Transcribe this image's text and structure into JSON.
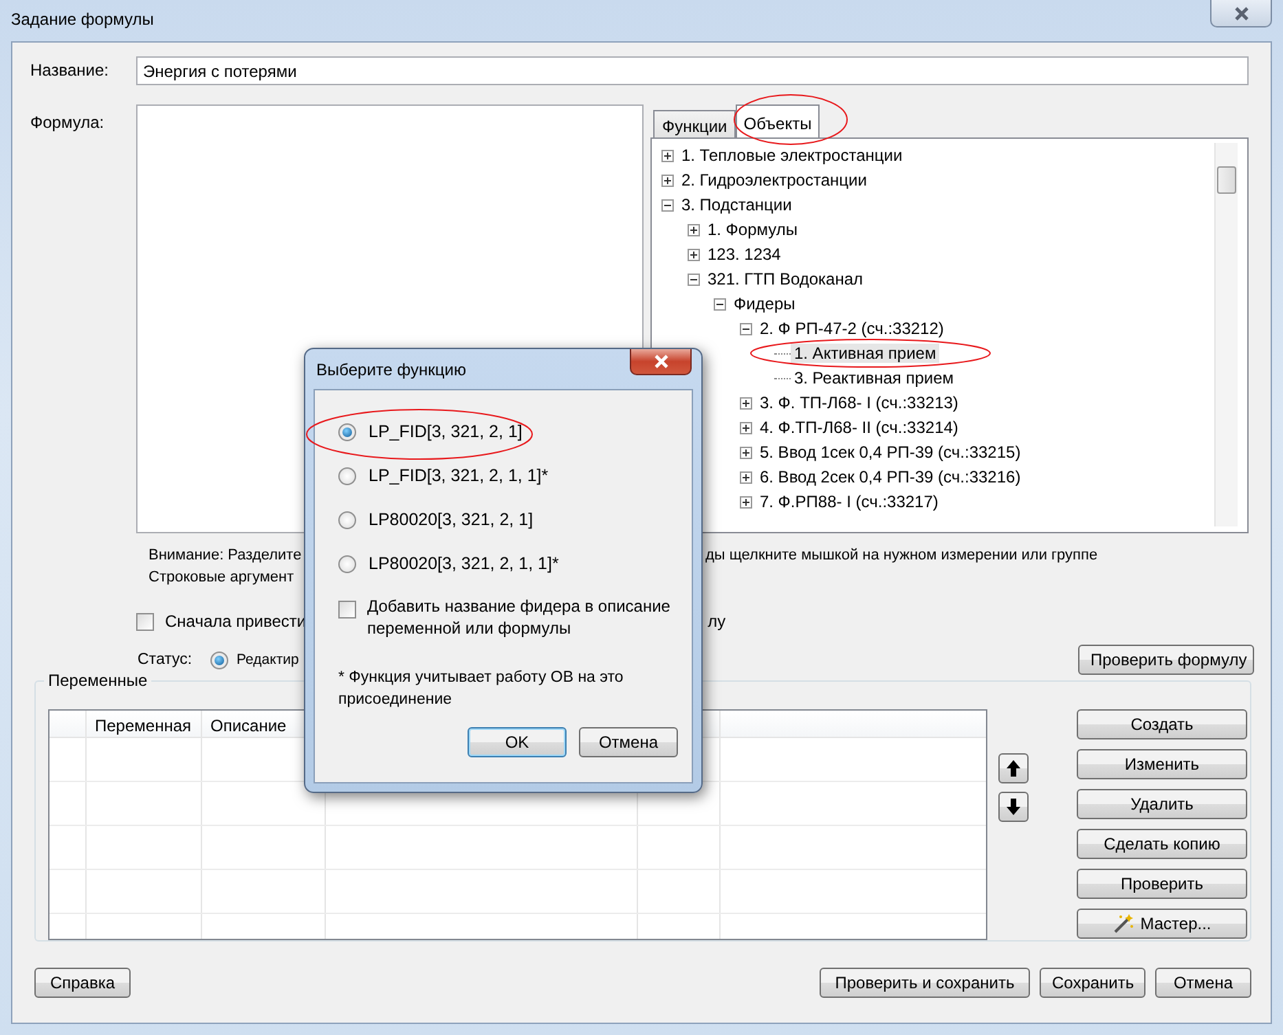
{
  "window": {
    "title": "Задание формулы"
  },
  "name_field": {
    "label": "Название:",
    "value": "Энергия с потерями"
  },
  "formula": {
    "label": "Формула:"
  },
  "tabs": [
    {
      "label": "Функции",
      "selected": false
    },
    {
      "label": "Объекты",
      "selected": true
    }
  ],
  "objects_tree": [
    {
      "label": "1. Тепловые электростанции",
      "expanded": false,
      "selected": false
    },
    {
      "label": "2. Гидроэлектростанции",
      "expanded": false,
      "selected": false
    },
    {
      "label": "3. Подстанции",
      "expanded": true,
      "selected": false,
      "children": [
        {
          "label": "1. Формулы",
          "expanded": false,
          "selected": false
        },
        {
          "label": "123. 1234",
          "expanded": false,
          "selected": false
        },
        {
          "label": "321. ГТП Водоканал",
          "expanded": true,
          "selected": false,
          "children": [
            {
              "label": "Фидеры",
              "expanded": true,
              "selected": false,
              "children": [
                {
                  "label": "2. Ф РП-47-2 (сч.:33212)",
                  "expanded": true,
                  "selected": false,
                  "children": [
                    {
                      "label": "1. Активная прием",
                      "selected": true
                    },
                    {
                      "label": "3. Реактивная прием",
                      "selected": false
                    }
                  ]
                },
                {
                  "label": "3. Ф. ТП-Л68-  I (сч.:33213)",
                  "expanded": false,
                  "selected": false
                },
                {
                  "label": "4. Ф.ТП-Л68- II (сч.:33214)",
                  "expanded": false,
                  "selected": false
                },
                {
                  "label": "5. Ввод 1сек 0,4 РП-39 (сч.:33215)",
                  "expanded": false,
                  "selected": false
                },
                {
                  "label": "6. Ввод 2сек 0,4 РП-39 (сч.:33216)",
                  "expanded": false,
                  "selected": false
                },
                {
                  "label": "7. Ф.РП88- I (сч.:33217)",
                  "expanded": false,
                  "selected": false
                }
              ]
            }
          ]
        }
      ]
    }
  ],
  "notes": {
    "line_1_left": "Внимание: Разделите",
    "line_1_right": "ды щелкните мышкой на нужном измерении или группе",
    "line_2_left": "Строковые аргумент"
  },
  "first_checkbox": {
    "label_left": "Сначала привести",
    "label_right": "лу",
    "checked": false
  },
  "status": {
    "label": "Статус:",
    "option": "Редактир",
    "selected": true
  },
  "check_formula_button": "Проверить формулу",
  "variables": {
    "title": "Переменные",
    "columns": [
      "Переменная",
      "Описание"
    ]
  },
  "side_buttons": [
    "Создать",
    "Изменить",
    "Удалить",
    "Сделать копию",
    "Проверить",
    "Мастер..."
  ],
  "footer": {
    "help": "Справка",
    "buttons": [
      "Проверить и сохранить",
      "Сохранить",
      "Отмена"
    ]
  },
  "dialog": {
    "title": "Выберите функцию",
    "options": [
      {
        "label": "LP_FID[3, 321, 2, 1]",
        "selected": true
      },
      {
        "label": "LP_FID[3, 321, 2, 1, 1]*",
        "selected": false
      },
      {
        "label": "LP80020[3, 321, 2, 1]",
        "selected": false
      },
      {
        "label": "LP80020[3, 321, 2, 1, 1]*",
        "selected": false
      }
    ],
    "checkbox": {
      "label": "Добавить название фидера в описание переменной или формулы",
      "checked": false
    },
    "note": "* Функция учитывает работу ОВ на это присоединение",
    "ok": "OK",
    "cancel": "Отмена"
  }
}
